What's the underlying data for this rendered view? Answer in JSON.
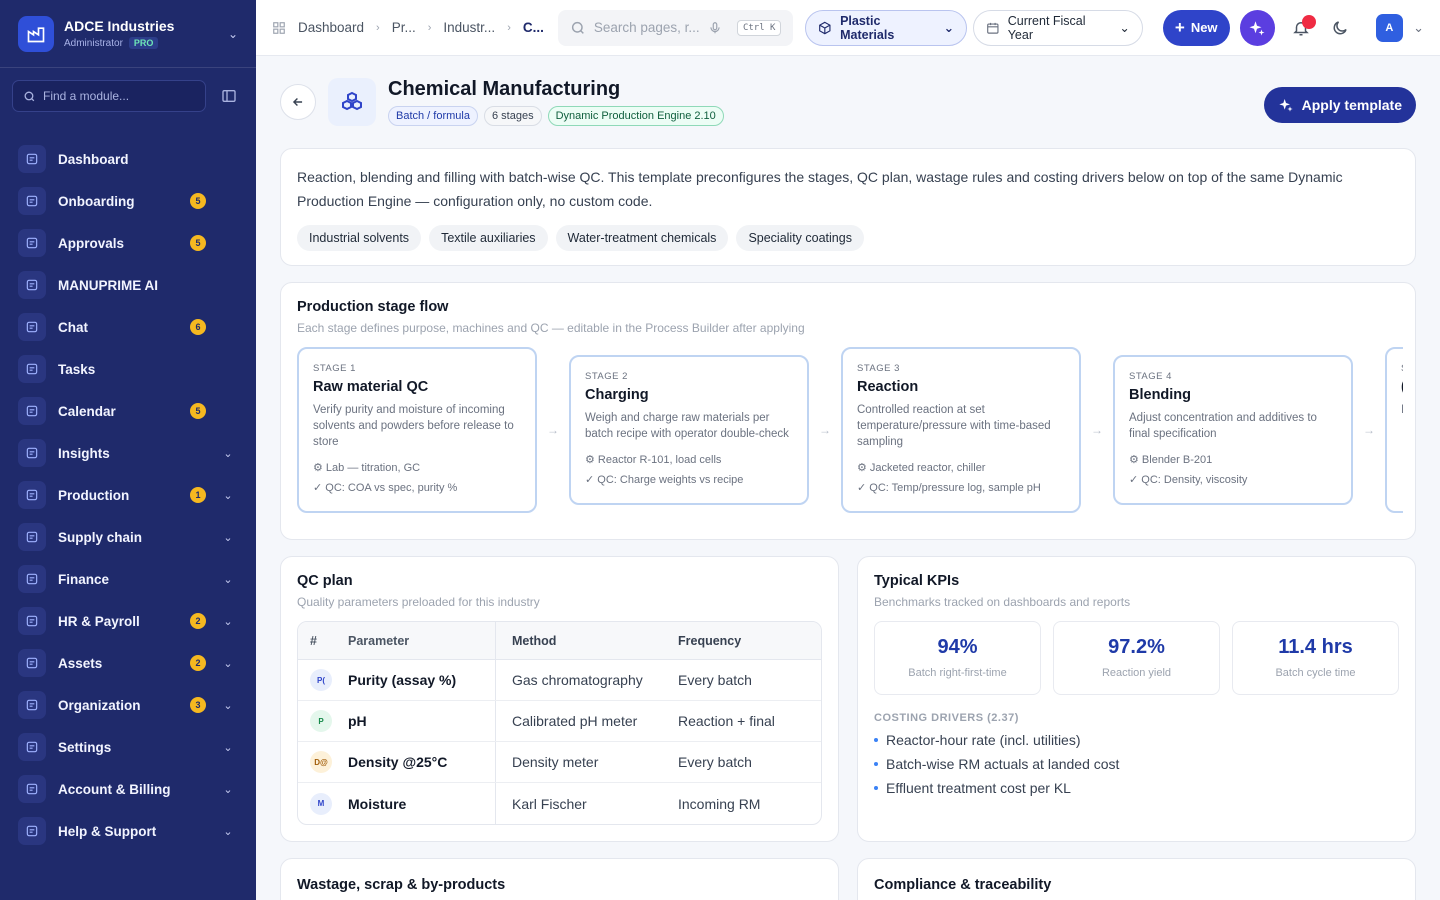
{
  "org": {
    "name": "ADCE Industries",
    "role": "Administrator",
    "plan": "PRO"
  },
  "sidebar": {
    "search_placeholder": "Find a module...",
    "items": [
      {
        "label": "Dashboard",
        "icon": "dashboard-icon",
        "badge": "",
        "chevron": false
      },
      {
        "label": "Onboarding",
        "icon": "clipboard-icon",
        "badge": "5",
        "chevron": false
      },
      {
        "label": "Approvals",
        "icon": "clipboard-check-icon",
        "badge": "5",
        "chevron": false
      },
      {
        "label": "MANUPRIME AI",
        "icon": "sparkle-icon",
        "badge": "",
        "chevron": false
      },
      {
        "label": "Chat",
        "icon": "chat-icon",
        "badge": "6",
        "chevron": false
      },
      {
        "label": "Tasks",
        "icon": "tasks-icon",
        "badge": "",
        "chevron": false
      },
      {
        "label": "Calendar",
        "icon": "calendar-icon",
        "badge": "5",
        "chevron": false
      },
      {
        "label": "Insights",
        "icon": "bar-chart-icon",
        "badge": "",
        "chevron": true
      },
      {
        "label": "Production",
        "icon": "factory-icon",
        "badge": "1",
        "chevron": true
      },
      {
        "label": "Supply chain",
        "icon": "trend-icon",
        "badge": "",
        "chevron": true
      },
      {
        "label": "Finance",
        "icon": "coin-icon",
        "badge": "",
        "chevron": true
      },
      {
        "label": "HR & Payroll",
        "icon": "users-icon",
        "badge": "2",
        "chevron": true
      },
      {
        "label": "Assets",
        "icon": "wrench-icon",
        "badge": "2",
        "chevron": true
      },
      {
        "label": "Organization",
        "icon": "building-icon",
        "badge": "3",
        "chevron": true
      },
      {
        "label": "Settings",
        "icon": "gear-icon",
        "badge": "",
        "chevron": true
      },
      {
        "label": "Account & Billing",
        "icon": "user-icon",
        "badge": "",
        "chevron": true
      },
      {
        "label": "Help & Support",
        "icon": "book-icon",
        "badge": "",
        "chevron": true
      }
    ]
  },
  "topbar": {
    "breadcrumbs": [
      "Dashboard",
      "Pr...",
      "Industr...",
      "C..."
    ],
    "search_placeholder": "Search pages, r...",
    "shortcut": "Ctrl K",
    "material_select": "Plastic Materials",
    "period_select": "Current Fiscal Year",
    "new_label": "New",
    "avatar_initial": "A"
  },
  "page": {
    "title": "Chemical Manufacturing",
    "tags": [
      "Batch / formula",
      "6 stages",
      "Dynamic Production Engine 2.10"
    ],
    "apply_label": "Apply template",
    "description": "Reaction, blending and filling with batch-wise QC. This template preconfigures the stages, QC plan, wastage rules and costing drivers below on top of the same Dynamic Production Engine — configuration only, no custom code.",
    "industries": [
      "Industrial solvents",
      "Textile auxiliaries",
      "Water-treatment chemicals",
      "Speciality coatings"
    ]
  },
  "flow": {
    "title": "Production stage flow",
    "subtitle": "Each stage defines purpose, machines and QC — editable in the Process Builder after applying",
    "stages": [
      {
        "num": "STAGE 1",
        "name": "Raw material QC",
        "purpose": "Verify purity and moisture of incoming solvents and powders before release to store",
        "machines": "⚙ Lab — titration, GC",
        "qc": "✓ QC: COA vs spec, purity %"
      },
      {
        "num": "STAGE 2",
        "name": "Charging",
        "purpose": "Weigh and charge raw materials per batch recipe with operator double-check",
        "machines": "⚙ Reactor R-101, load cells",
        "qc": "✓ QC: Charge weights vs recipe"
      },
      {
        "num": "STAGE 3",
        "name": "Reaction",
        "purpose": "Controlled reaction at set temperature/pressure with time-based sampling",
        "machines": "⚙ Jacketed reactor, chiller",
        "qc": "✓ QC: Temp/pressure log, sample pH"
      },
      {
        "num": "STAGE 4",
        "name": "Blending",
        "purpose": "Adjust concentration and additives to final specification",
        "machines": "⚙ Blender B-201",
        "qc": "✓ QC: Density, viscosity"
      },
      {
        "num": "S",
        "name": "(",
        "purpose": "I",
        "machines": "",
        "qc": ""
      }
    ]
  },
  "qc_plan": {
    "title": "QC plan",
    "subtitle": "Quality parameters preloaded for this industry",
    "columns": [
      "#",
      "Parameter",
      "Method",
      "Frequency"
    ],
    "rows": [
      {
        "abbr": "P(",
        "parameter": "Purity (assay %)",
        "method": "Gas chromatography",
        "frequency": "Every batch",
        "bg": "#e8eefc",
        "fg": "#2f44c9"
      },
      {
        "abbr": "P",
        "parameter": "pH",
        "method": "Calibrated pH meter",
        "frequency": "Reaction + final",
        "bg": "#e4f7ec",
        "fg": "#168a4a"
      },
      {
        "abbr": "D@",
        "parameter": "Density @25°C",
        "method": "Density meter",
        "frequency": "Every batch",
        "bg": "#fdf1d9",
        "fg": "#a15c07"
      },
      {
        "abbr": "M",
        "parameter": "Moisture",
        "method": "Karl Fischer",
        "frequency": "Incoming RM",
        "bg": "#e8eefc",
        "fg": "#2f44c9"
      }
    ]
  },
  "kpis": {
    "title": "Typical KPIs",
    "subtitle": "Benchmarks tracked on dashboards and reports",
    "items": [
      {
        "value": "94%",
        "label": "Batch right-first-time"
      },
      {
        "value": "97.2%",
        "label": "Reaction yield"
      },
      {
        "value": "11.4 hrs",
        "label": "Batch cycle time"
      }
    ],
    "drivers_title": "COSTING DRIVERS (2.37)",
    "drivers": [
      "Reactor-hour rate (incl. utilities)",
      "Batch-wise RM actuals at landed cost",
      "Effluent treatment cost per KL"
    ]
  },
  "bottom": {
    "wastage_title": "Wastage, scrap & by-products",
    "compliance_title": "Compliance & traceability"
  }
}
